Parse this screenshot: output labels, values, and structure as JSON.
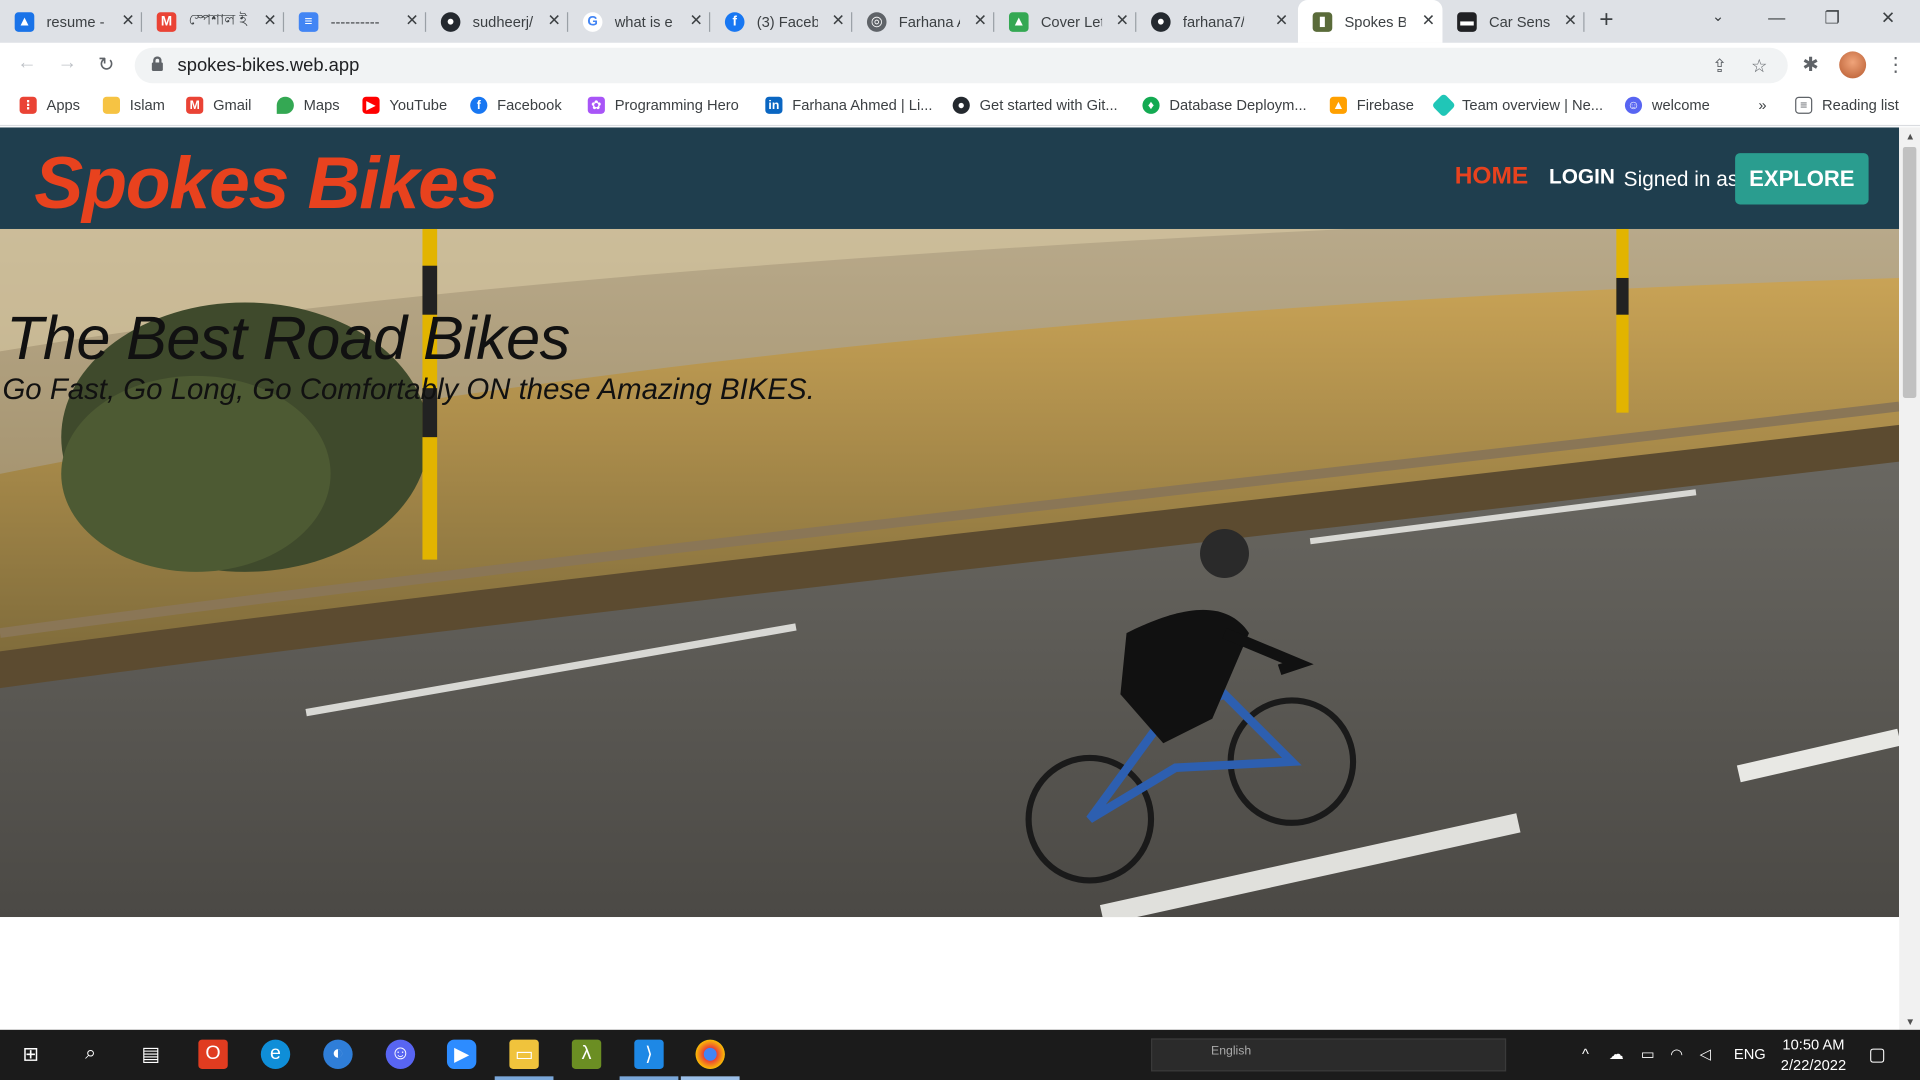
{
  "browser": {
    "tabs": [
      {
        "title": "resume -",
        "favicon": "google-drive-icon",
        "color": "#1a73e8"
      },
      {
        "title": "স্পেশাল ই",
        "favicon": "gmail-icon",
        "color": "#ea4335"
      },
      {
        "title": "----------",
        "favicon": "google-docs-icon",
        "color": "#4285f4"
      },
      {
        "title": "sudheerj/",
        "favicon": "github-icon",
        "color": "#24292f"
      },
      {
        "title": "what is e",
        "favicon": "google-icon",
        "color": "#4285f4"
      },
      {
        "title": "(3) Faceb",
        "favicon": "facebook-icon",
        "color": "#1877f2"
      },
      {
        "title": "Farhana A",
        "favicon": "globe-icon",
        "color": "#5f6368"
      },
      {
        "title": "Cover Let",
        "favicon": "google-drive-icon",
        "color": "#34a853"
      },
      {
        "title": "farhana7/",
        "favicon": "github-icon",
        "color": "#24292f"
      },
      {
        "title": "Spokes B",
        "favicon": "spokes-icon",
        "color": "#5a6b3a"
      },
      {
        "title": "Car Senso",
        "favicon": "car-icon",
        "color": "#202124"
      }
    ],
    "active_tab_index": 9,
    "url": "spokes-bikes.web.app",
    "bookmarks": [
      {
        "label": "Apps",
        "icon": "apps-grid-icon",
        "color": "#ea4335"
      },
      {
        "label": "Islam",
        "icon": "folder-icon",
        "color": "#f6c343"
      },
      {
        "label": "Gmail",
        "icon": "gmail-icon",
        "color": "#ea4335"
      },
      {
        "label": "Maps",
        "icon": "maps-icon",
        "color": "#34a853"
      },
      {
        "label": "YouTube",
        "icon": "youtube-icon",
        "color": "#ff0000"
      },
      {
        "label": "Facebook",
        "icon": "facebook-icon",
        "color": "#1877f2"
      },
      {
        "label": "Programming Hero",
        "icon": "programming-hero-icon",
        "color": "#a855f7"
      },
      {
        "label": "Farhana Ahmed | Li...",
        "icon": "linkedin-icon",
        "color": "#0a66c2"
      },
      {
        "label": "Get started with Git...",
        "icon": "github-icon",
        "color": "#24292f"
      },
      {
        "label": "Database Deploym...",
        "icon": "mongodb-icon",
        "color": "#13aa52"
      },
      {
        "label": "Firebase",
        "icon": "firebase-icon",
        "color": "#ffa000"
      },
      {
        "label": "Team overview | Ne...",
        "icon": "netlify-icon",
        "color": "#20c6b7"
      },
      {
        "label": "welcome",
        "icon": "discord-icon",
        "color": "#5865f2"
      }
    ],
    "reading_list": "Reading list"
  },
  "site": {
    "brand": "Spokes Bikes",
    "nav": {
      "home": "HOME",
      "login": "LOGIN",
      "signed_in": "Signed in as:",
      "explore": "EXPLORE"
    },
    "hero": {
      "title": "The Best Road Bikes",
      "subtitle": "Go Fast, Go Long, Go Comfortably ON these Amazing BIKES."
    },
    "colors": {
      "navbar": "#1f3e4e",
      "brand": "#e8421e",
      "explore_button": "#2a9d8f"
    }
  },
  "taskbar": {
    "apps": [
      "start-icon",
      "search-icon",
      "task-view-icon",
      "office-icon",
      "edge-icon",
      "firefox-icon",
      "discord-icon",
      "zoom-icon",
      "file-explorer-icon",
      "lambda-icon",
      "vscode-icon",
      "chrome-icon"
    ],
    "language_bar": "English",
    "input_language": "ENG",
    "time": "10:50 AM",
    "date": "2/22/2022"
  }
}
